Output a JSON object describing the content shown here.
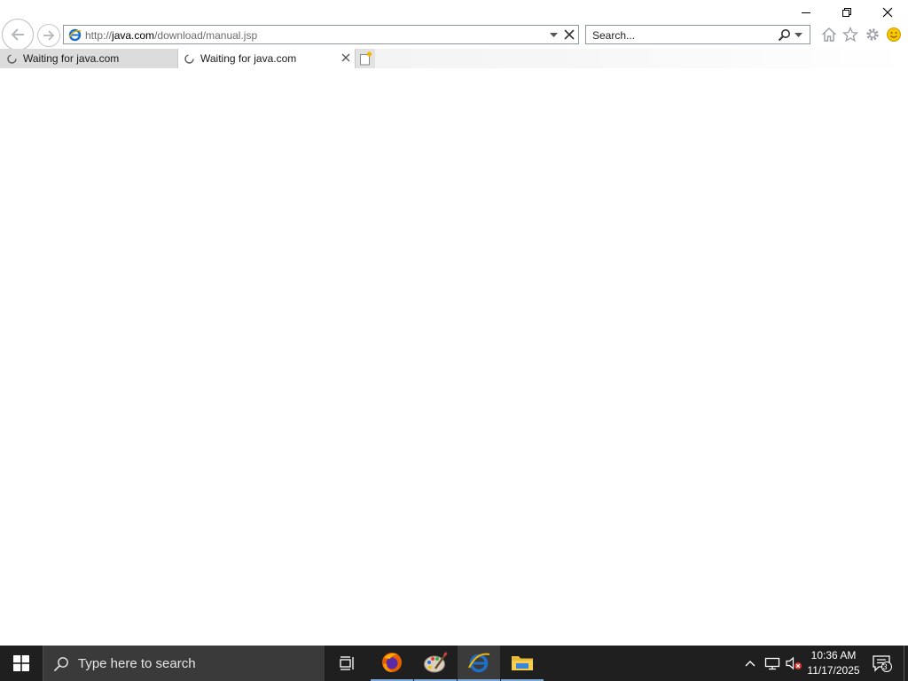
{
  "browser": {
    "address": {
      "prefix": "http://",
      "domain": "java.com",
      "path": "/download/manual.jsp"
    },
    "search": {
      "placeholder": "Search..."
    },
    "tabs": [
      {
        "label": "Waiting for java.com",
        "active": false
      },
      {
        "label": "Waiting for java.com",
        "active": true
      }
    ],
    "icons": {
      "back": "back-arrow-icon",
      "forward": "forward-arrow-icon",
      "home": "home-icon",
      "favorites": "star-icon",
      "tools": "gear-icon",
      "feedback": "smiley-icon"
    }
  },
  "taskbar": {
    "search_placeholder": "Type here to search",
    "apps": [
      "task-view",
      "firefox",
      "paint",
      "internet-explorer",
      "file-explorer"
    ],
    "clock": {
      "time": "10:36 AM",
      "date": "11/17/2025"
    },
    "notification_count": "3"
  },
  "colors": {
    "taskbar_bg": "#1f1f1f",
    "taskbar_search_bg": "#3a3a3a",
    "running_indicator": "#7aa7d6",
    "ie_blue": "#1e6fc8"
  }
}
